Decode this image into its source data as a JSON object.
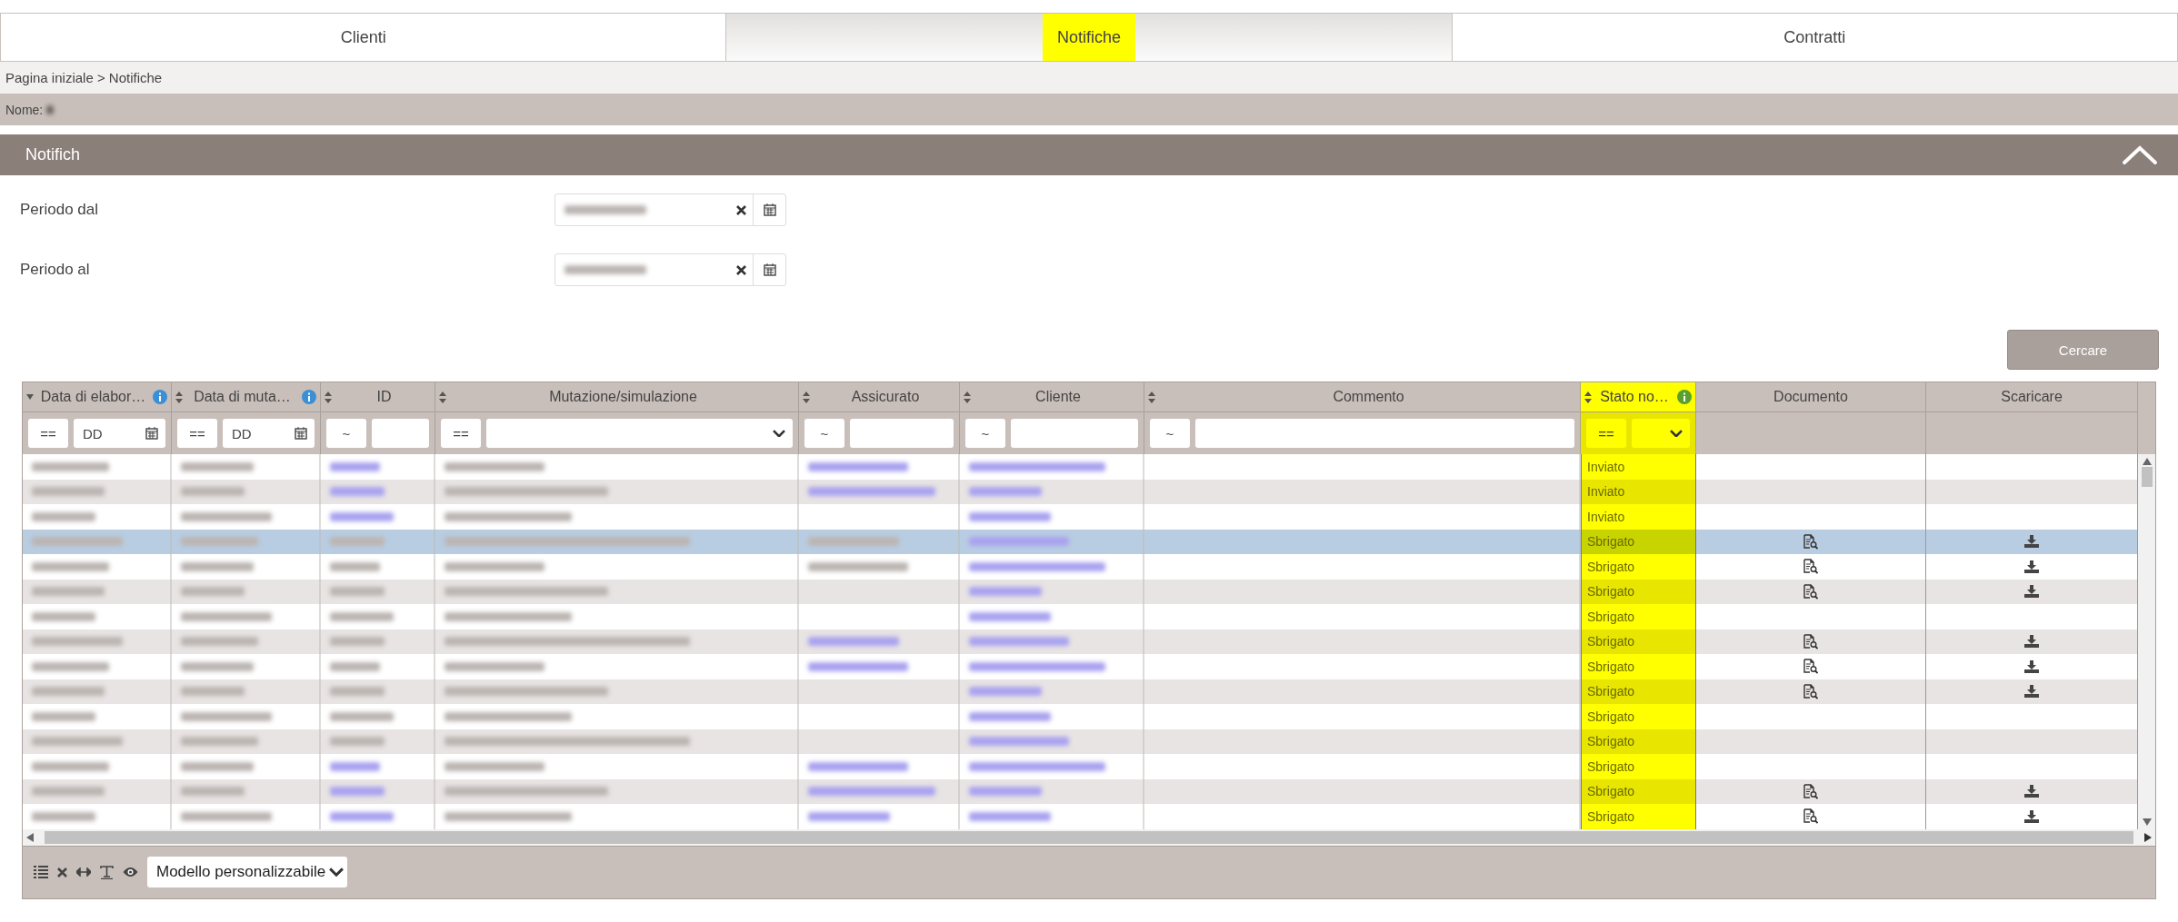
{
  "tabs": [
    {
      "label": "Clienti",
      "selected": false,
      "highlight": false
    },
    {
      "label": "Notifiche",
      "selected": true,
      "highlight": true
    },
    {
      "label": "Contratti",
      "selected": false,
      "highlight": false
    }
  ],
  "breadcrumb": "Pagina iniziale > Notifiche",
  "name_bar": {
    "label": "Nome:",
    "blurred": true
  },
  "section": {
    "title": "Notifich",
    "expanded": true
  },
  "form": [
    {
      "label": "Periodo dal",
      "blurred": true
    },
    {
      "label": "Periodo al",
      "blurred": true
    }
  ],
  "search_button": "Cercare",
  "table": {
    "columns": [
      {
        "label": "Data di elabor…",
        "kind": "sorted",
        "info": {
          "color": "#3a8fd6"
        },
        "highlight": false,
        "filter": {
          "kind": "date",
          "op": "==",
          "value": "DD"
        }
      },
      {
        "label": "Data di muta…",
        "kind": "sortable",
        "info": {
          "color": "#3a8fd6"
        },
        "highlight": false,
        "filter": {
          "kind": "date",
          "op": "==",
          "value": "DD"
        }
      },
      {
        "label": "ID",
        "kind": "sortable",
        "highlight": false,
        "filter": {
          "kind": "text",
          "op": "~"
        }
      },
      {
        "label": "Mutazione/simulazione",
        "kind": "sortable",
        "highlight": false,
        "filter": {
          "kind": "select",
          "op": "=="
        }
      },
      {
        "label": "Assicurato",
        "kind": "sortable",
        "highlight": false,
        "filter": {
          "kind": "text",
          "op": "~"
        }
      },
      {
        "label": "Cliente",
        "kind": "sortable",
        "highlight": false,
        "filter": {
          "kind": "text",
          "op": "~"
        }
      },
      {
        "label": "Commento",
        "kind": "sortable",
        "highlight": false,
        "filter": {
          "kind": "text",
          "op": "~"
        }
      },
      {
        "label": "Stato no…",
        "kind": "sortable",
        "info": {
          "color": "#5aa02c"
        },
        "highlight": true,
        "filter": {
          "kind": "select",
          "op": "=="
        }
      },
      {
        "label": "Documento",
        "kind": "plain",
        "highlight": false,
        "filter": {
          "kind": "none"
        }
      },
      {
        "label": "Scaricare",
        "kind": "plain",
        "highlight": false,
        "filter": {
          "kind": "none"
        }
      }
    ],
    "rows": [
      {
        "selected": false,
        "cells": [
          {
            "kind": "plain"
          },
          {
            "kind": "plain"
          },
          {
            "kind": "link"
          },
          {
            "kind": "plain"
          },
          {
            "kind": "link"
          },
          {
            "kind": "link"
          },
          {
            "kind": "empty"
          }
        ],
        "status": "Inviato",
        "document": false,
        "download": false
      },
      {
        "selected": false,
        "cells": [
          {
            "kind": "plain"
          },
          {
            "kind": "plain"
          },
          {
            "kind": "link"
          },
          {
            "kind": "plain"
          },
          {
            "kind": "link"
          },
          {
            "kind": "link"
          },
          {
            "kind": "empty"
          }
        ],
        "status": "Inviato",
        "document": false,
        "download": false
      },
      {
        "selected": false,
        "cells": [
          {
            "kind": "plain"
          },
          {
            "kind": "plain"
          },
          {
            "kind": "link"
          },
          {
            "kind": "plain"
          },
          {
            "kind": "empty"
          },
          {
            "kind": "link"
          },
          {
            "kind": "empty"
          }
        ],
        "status": "Inviato",
        "document": false,
        "download": false
      },
      {
        "selected": true,
        "cells": [
          {
            "kind": "plain"
          },
          {
            "kind": "plain"
          },
          {
            "kind": "plain"
          },
          {
            "kind": "plain"
          },
          {
            "kind": "plain"
          },
          {
            "kind": "link"
          },
          {
            "kind": "empty"
          }
        ],
        "status": "Sbrigato",
        "document": true,
        "download": true
      },
      {
        "selected": false,
        "cells": [
          {
            "kind": "plain"
          },
          {
            "kind": "plain"
          },
          {
            "kind": "plain"
          },
          {
            "kind": "plain"
          },
          {
            "kind": "plain"
          },
          {
            "kind": "link"
          },
          {
            "kind": "empty"
          }
        ],
        "status": "Sbrigato",
        "document": true,
        "download": true
      },
      {
        "selected": false,
        "cells": [
          {
            "kind": "plain"
          },
          {
            "kind": "plain"
          },
          {
            "kind": "plain"
          },
          {
            "kind": "plain"
          },
          {
            "kind": "empty"
          },
          {
            "kind": "link"
          },
          {
            "kind": "empty"
          }
        ],
        "status": "Sbrigato",
        "document": true,
        "download": true
      },
      {
        "selected": false,
        "cells": [
          {
            "kind": "plain"
          },
          {
            "kind": "plain"
          },
          {
            "kind": "plain"
          },
          {
            "kind": "plain"
          },
          {
            "kind": "empty"
          },
          {
            "kind": "link"
          },
          {
            "kind": "empty"
          }
        ],
        "status": "Sbrigato",
        "document": false,
        "download": false
      },
      {
        "selected": false,
        "cells": [
          {
            "kind": "plain"
          },
          {
            "kind": "plain"
          },
          {
            "kind": "plain"
          },
          {
            "kind": "plain"
          },
          {
            "kind": "link"
          },
          {
            "kind": "link"
          },
          {
            "kind": "empty"
          }
        ],
        "status": "Sbrigato",
        "document": true,
        "download": true
      },
      {
        "selected": false,
        "cells": [
          {
            "kind": "plain"
          },
          {
            "kind": "plain"
          },
          {
            "kind": "plain"
          },
          {
            "kind": "plain"
          },
          {
            "kind": "link"
          },
          {
            "kind": "link"
          },
          {
            "kind": "empty"
          }
        ],
        "status": "Sbrigato",
        "document": true,
        "download": true
      },
      {
        "selected": false,
        "cells": [
          {
            "kind": "plain"
          },
          {
            "kind": "plain"
          },
          {
            "kind": "plain"
          },
          {
            "kind": "plain"
          },
          {
            "kind": "empty"
          },
          {
            "kind": "link"
          },
          {
            "kind": "empty"
          }
        ],
        "status": "Sbrigato",
        "document": true,
        "download": true
      },
      {
        "selected": false,
        "cells": [
          {
            "kind": "plain"
          },
          {
            "kind": "plain"
          },
          {
            "kind": "plain"
          },
          {
            "kind": "plain"
          },
          {
            "kind": "empty"
          },
          {
            "kind": "link"
          },
          {
            "kind": "empty"
          }
        ],
        "status": "Sbrigato",
        "document": false,
        "download": false
      },
      {
        "selected": false,
        "cells": [
          {
            "kind": "plain"
          },
          {
            "kind": "plain"
          },
          {
            "kind": "plain"
          },
          {
            "kind": "plain"
          },
          {
            "kind": "empty"
          },
          {
            "kind": "link"
          },
          {
            "kind": "empty"
          }
        ],
        "status": "Sbrigato",
        "document": false,
        "download": false
      },
      {
        "selected": false,
        "cells": [
          {
            "kind": "plain"
          },
          {
            "kind": "plain"
          },
          {
            "kind": "link"
          },
          {
            "kind": "plain"
          },
          {
            "kind": "link"
          },
          {
            "kind": "link"
          },
          {
            "kind": "empty"
          }
        ],
        "status": "Sbrigato",
        "document": false,
        "download": false
      },
      {
        "selected": false,
        "cells": [
          {
            "kind": "plain"
          },
          {
            "kind": "plain"
          },
          {
            "kind": "link"
          },
          {
            "kind": "plain"
          },
          {
            "kind": "link"
          },
          {
            "kind": "link"
          },
          {
            "kind": "empty"
          }
        ],
        "status": "Sbrigato",
        "document": true,
        "download": true
      },
      {
        "selected": false,
        "cells": [
          {
            "kind": "plain"
          },
          {
            "kind": "plain"
          },
          {
            "kind": "link"
          },
          {
            "kind": "plain"
          },
          {
            "kind": "link"
          },
          {
            "kind": "link"
          },
          {
            "kind": "empty"
          }
        ],
        "status": "Sbrigato",
        "document": true,
        "download": true
      }
    ]
  },
  "footer": {
    "template_select": "Modello personalizzabile"
  }
}
